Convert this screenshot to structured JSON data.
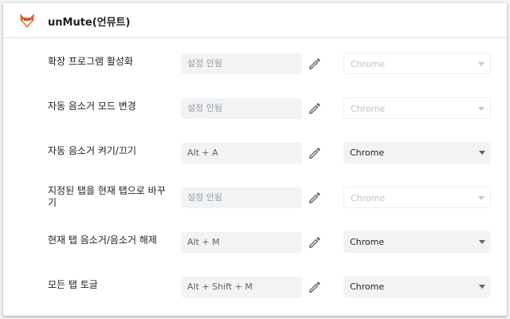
{
  "extension": {
    "name": "unMute(언뮤트)",
    "icon": "fox-icon"
  },
  "colors": {
    "background": "#f1f3f4",
    "card": "#ffffff",
    "field": "#f1f3f4",
    "placeholder_text": "#9aa0a6",
    "disabled_text": "#bdc1c6",
    "fox_orange": "#e8602c"
  },
  "commands": [
    {
      "label": "확장 프로그램 활성화",
      "shortcut": "설정 안됨",
      "shortcut_set": false,
      "scope": "Chrome",
      "scope_enabled": false
    },
    {
      "label": "자동 음소거 모드 변경",
      "shortcut": "설정 안됨",
      "shortcut_set": false,
      "scope": "Chrome",
      "scope_enabled": false
    },
    {
      "label": "자동 음소거 켜기/끄기",
      "shortcut": "Alt + A",
      "shortcut_set": true,
      "scope": "Chrome",
      "scope_enabled": true
    },
    {
      "label": "지정된 탭을 현재 탭으로 바꾸기",
      "shortcut": "설정 안됨",
      "shortcut_set": false,
      "scope": "Chrome",
      "scope_enabled": false
    },
    {
      "label": "현재 탭 음소거/음소거 해제",
      "shortcut": "Alt + M",
      "shortcut_set": true,
      "scope": "Chrome",
      "scope_enabled": true
    },
    {
      "label": "모든 탭 토글",
      "shortcut": "Alt + Shift + M",
      "shortcut_set": true,
      "scope": "Chrome",
      "scope_enabled": true
    }
  ],
  "icons": {
    "edit": "pencil-icon",
    "dropdown": "chevron-down-icon"
  }
}
